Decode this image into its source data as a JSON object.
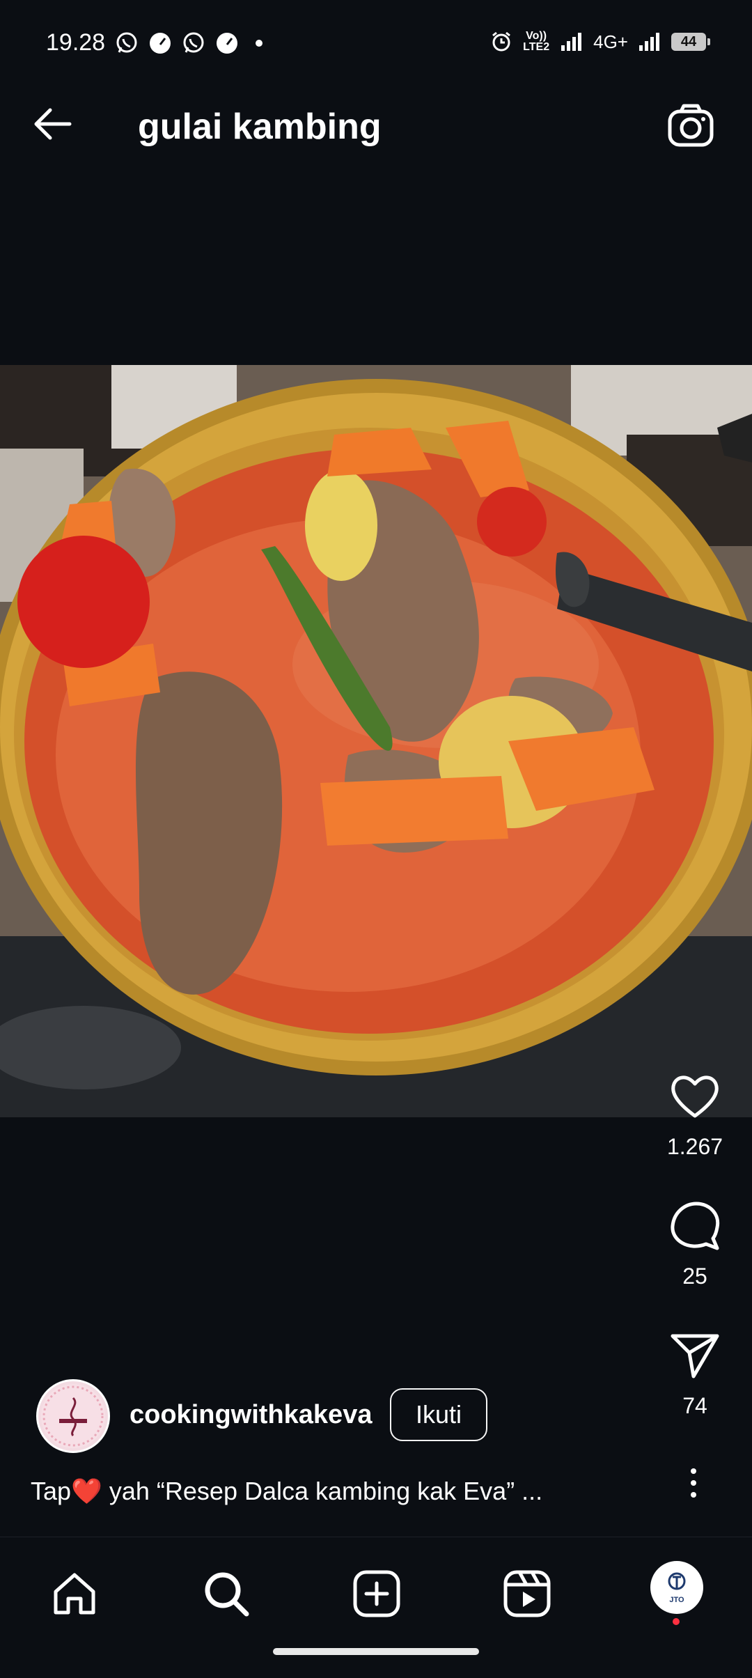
{
  "status_bar": {
    "time": "19.28",
    "network": "4G+",
    "lte_label": "Vo)) LTE2",
    "battery": "44",
    "icons": [
      "whatsapp-icon",
      "speedometer-icon",
      "whatsapp-icon",
      "speedometer-icon",
      "dot-icon",
      "alarm-icon",
      "signal-icon",
      "signal-icon"
    ]
  },
  "header": {
    "title": "gulai kambing",
    "back_icon": "arrow-left-icon",
    "camera_icon": "camera-icon"
  },
  "post": {
    "image_description_icon": "food-photo",
    "likes": "1.267",
    "comments": "25",
    "shares": "74",
    "username": "cookingwithkakeva",
    "follow_label": "Ikuti",
    "caption_prefix": "Tap",
    "caption_emoji": "❤️",
    "caption_text": " yah “Resep Dalca kambing kak Eva” ..."
  },
  "bottom_nav": {
    "items": [
      "home-icon",
      "search-icon",
      "create-icon",
      "reels-icon",
      "profile-avatar"
    ],
    "profile_avatar_text": "JTO"
  },
  "colors": {
    "background": "#0b0e13",
    "notification_dot": "#ff3040"
  }
}
